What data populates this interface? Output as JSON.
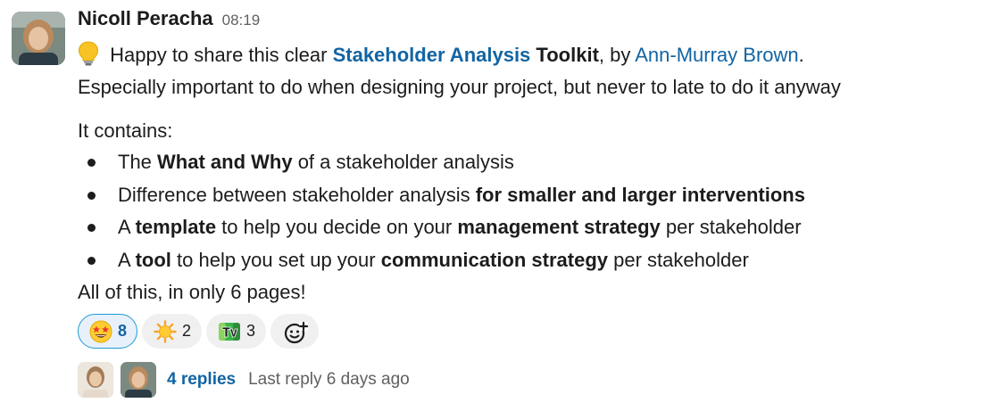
{
  "message": {
    "sender": "Nicoll Peracha",
    "time": "08:19",
    "line1": {
      "emoji": "bulb-icon",
      "t1": " Happy to share this clear ",
      "link1": "Stakeholder Analysis",
      "t2": " ",
      "bold1": "Toolkit",
      "t3": ", by ",
      "link2": "Ann-Murray Brown",
      "t4": "."
    },
    "line2": "Especially important to do when designing your project, but never to late to do it anyway",
    "line3": "It contains:",
    "bullets": [
      {
        "a": "The ",
        "b": "What and Why",
        "c": " of a stakeholder analysis"
      },
      {
        "a": "Difference between stakeholder analysis ",
        "b": "for smaller and larger interventions",
        "c": ""
      },
      {
        "a": "A ",
        "b": "template",
        "c": " to help you decide on your ",
        "d": "management strategy",
        "e": " per stakeholder"
      },
      {
        "a": "A ",
        "b": "tool",
        "c": " to help you set up your ",
        "d": "communication strategy",
        "e": " per stakeholder"
      }
    ],
    "line4": "All of this, in only 6 pages!"
  },
  "reactions": [
    {
      "icon": "star-struck-emoji-icon",
      "count": "8",
      "mine": true
    },
    {
      "icon": "sun-emoji-icon",
      "count": "2",
      "mine": false
    },
    {
      "icon": "tv-emoji-icon",
      "count": "3",
      "mine": false
    }
  ],
  "add_reaction_icon": "add-reaction-icon",
  "thread": {
    "replies": "4 replies",
    "last_reply": "Last reply 6 days ago"
  },
  "colors": {
    "link": "#1264a3",
    "text": "#1d1c1d",
    "muted": "#616061",
    "reaction_bg": "#f0f0f0",
    "reaction_mine_bg": "#e8f1fb",
    "reaction_mine_border": "#1d9bd1"
  }
}
